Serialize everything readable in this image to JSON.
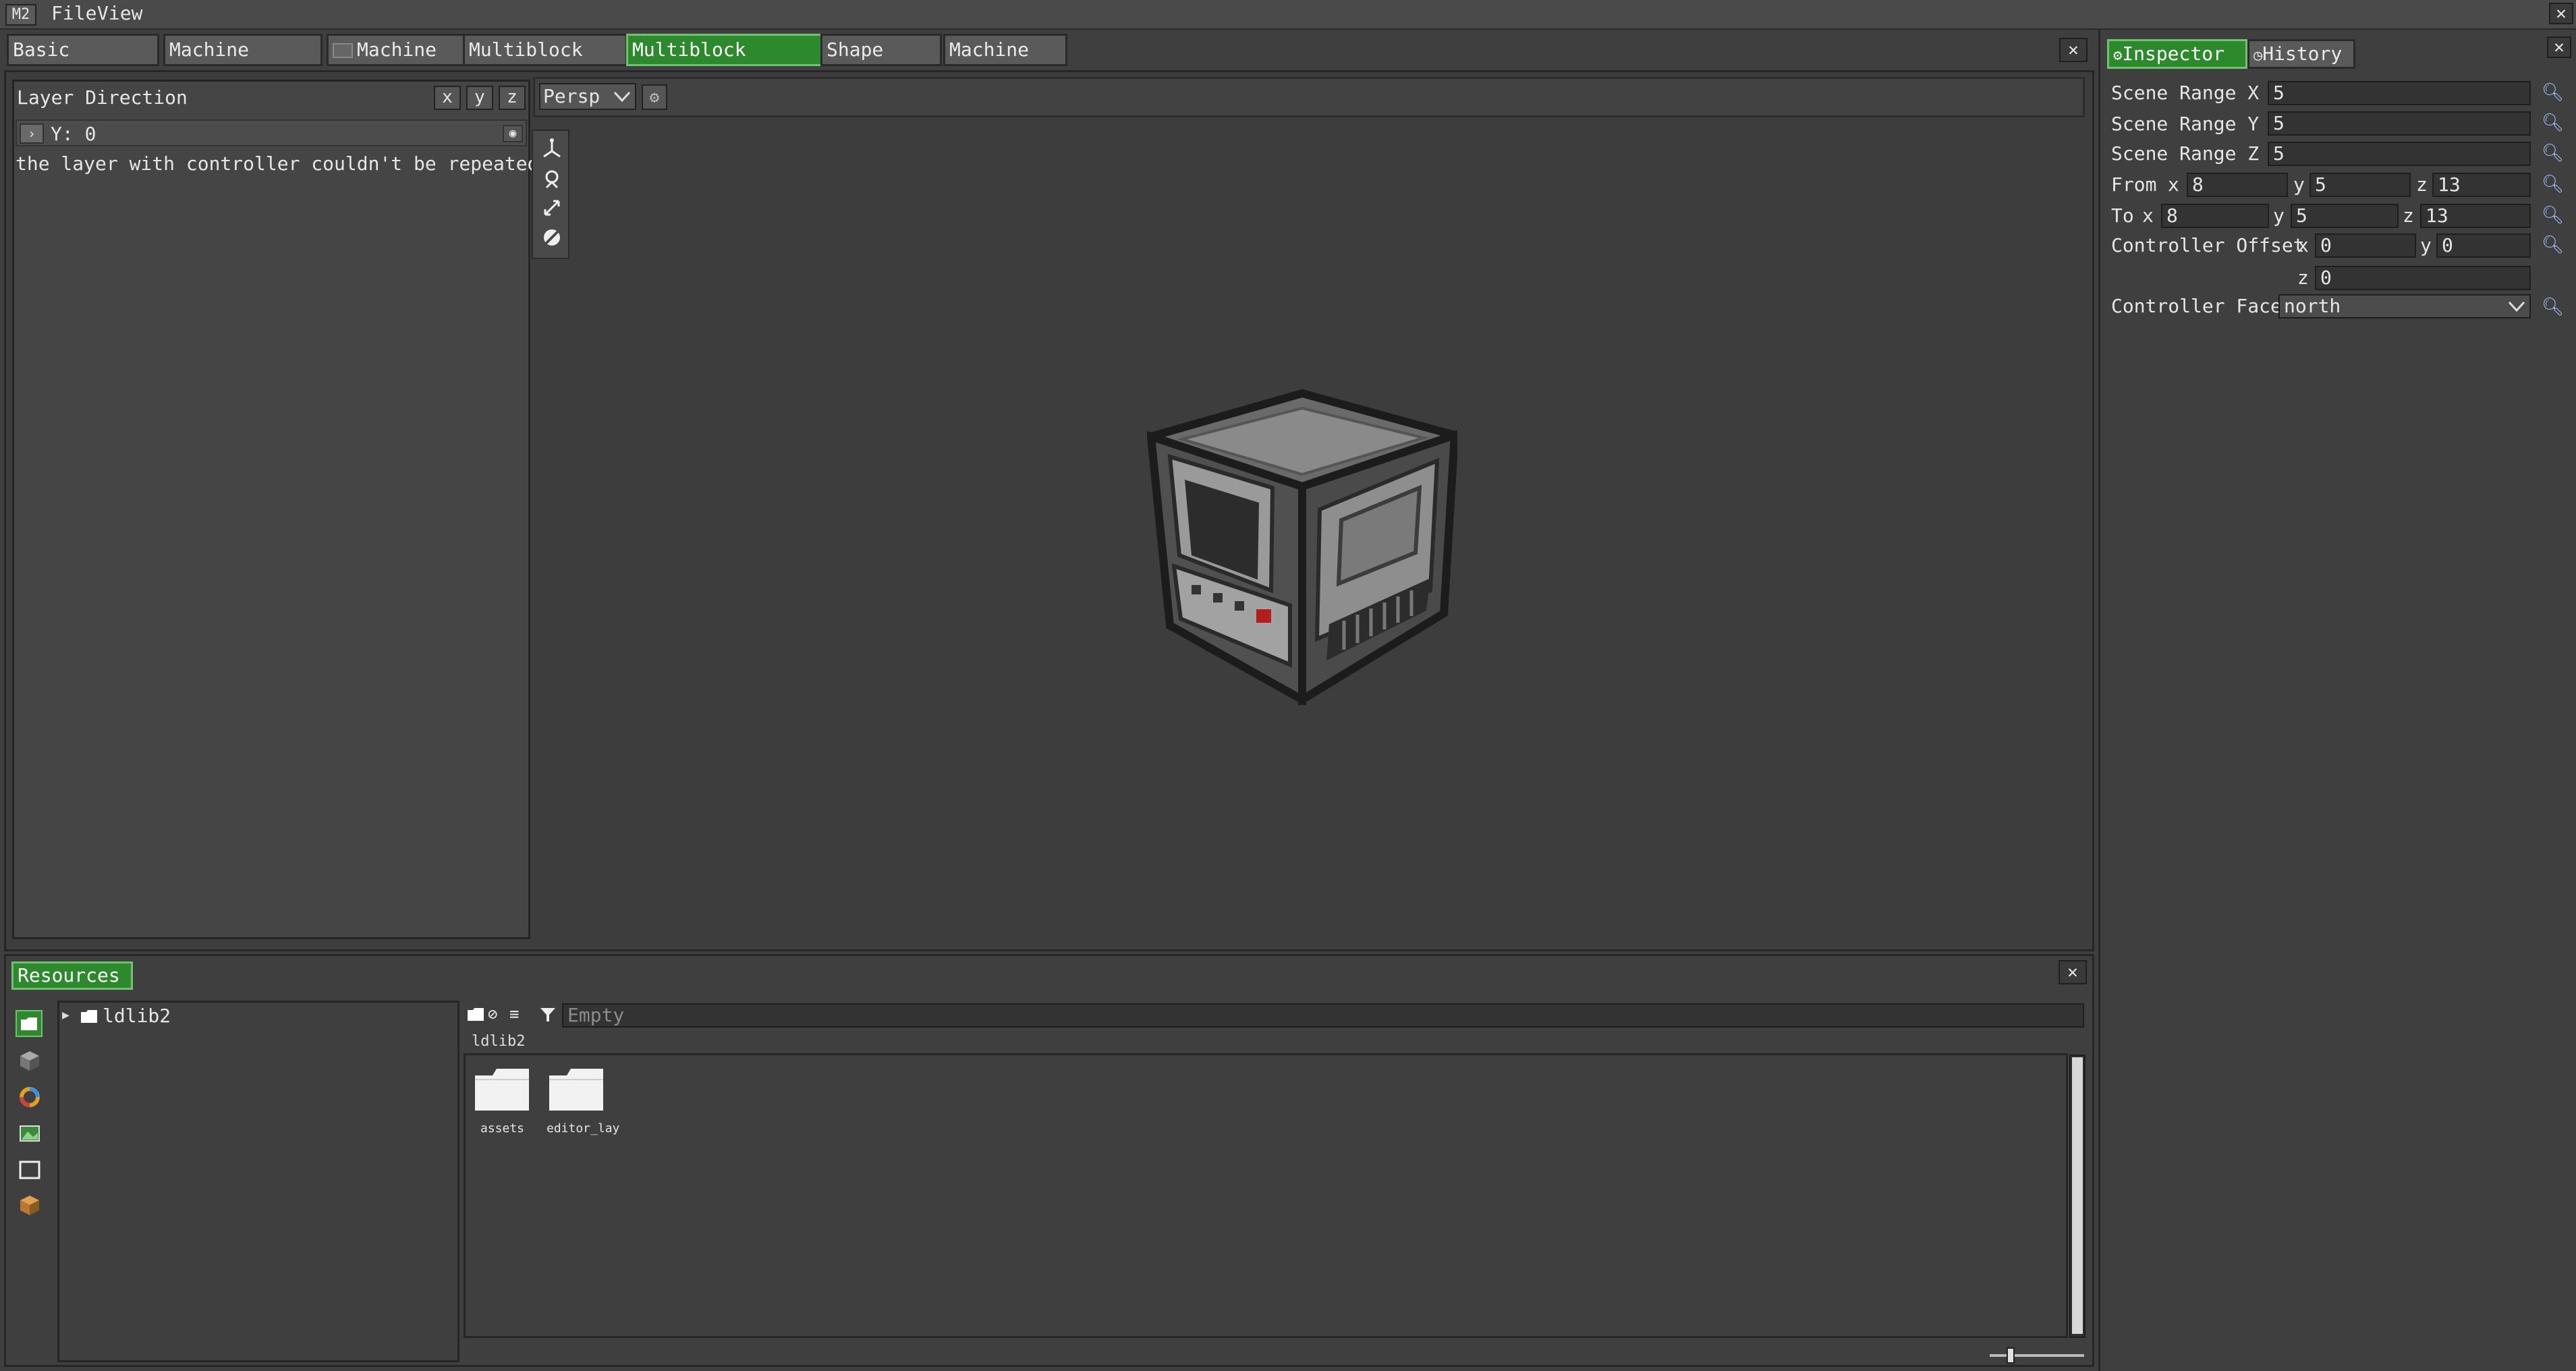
{
  "app": {
    "logo_text": "M2",
    "menu": [
      "File",
      "View"
    ]
  },
  "tabs": [
    {
      "label": "Basic Settings"
    },
    {
      "label": "Machine Traits"
    },
    {
      "label": "Machine UI"
    },
    {
      "label": "Multiblock Area"
    },
    {
      "label": "Multiblock Pattern"
    },
    {
      "label": "Shape Info"
    },
    {
      "label": "Machine FX"
    }
  ],
  "layer_panel": {
    "title": "Layer Direction",
    "axes": [
      "x",
      "y",
      "z"
    ],
    "layer_label": "Y: 0",
    "warning": "the layer with controller couldn't be repeated"
  },
  "scene": {
    "projection": "Persp"
  },
  "inspector": {
    "tabs": [
      "Inspector",
      "History"
    ],
    "scene_range": [
      {
        "label": "Scene Range X",
        "value": "5"
      },
      {
        "label": "Scene Range Y",
        "value": "5"
      },
      {
        "label": "Scene Range Z",
        "value": "5"
      }
    ],
    "from": {
      "label": "From",
      "x_label": "x",
      "y_label": "y",
      "z_label": "z",
      "x": "8",
      "y": "5",
      "z": "13"
    },
    "to": {
      "label": "To",
      "x_label": "x",
      "y_label": "y",
      "z_label": "z",
      "x": "8",
      "y": "5",
      "z": "13"
    },
    "controller_offset": {
      "label": "Controller Offset",
      "x_label": "x",
      "y_label": "y",
      "z_label": "z",
      "x": "0",
      "y": "0",
      "z": "0"
    },
    "controller_face": {
      "label": "Controller Face",
      "value": "north"
    }
  },
  "resources": {
    "tab_label": "Resources",
    "tree_root": "ldlib2",
    "search_placeholder": "Empty",
    "path": "ldlib2",
    "files": [
      {
        "name": "assets"
      },
      {
        "name": "editor_lay"
      }
    ],
    "zoom_fraction": 0.2
  },
  "colors": {
    "accent_green": "#2c8a2c",
    "background": "#3f3f3f"
  }
}
